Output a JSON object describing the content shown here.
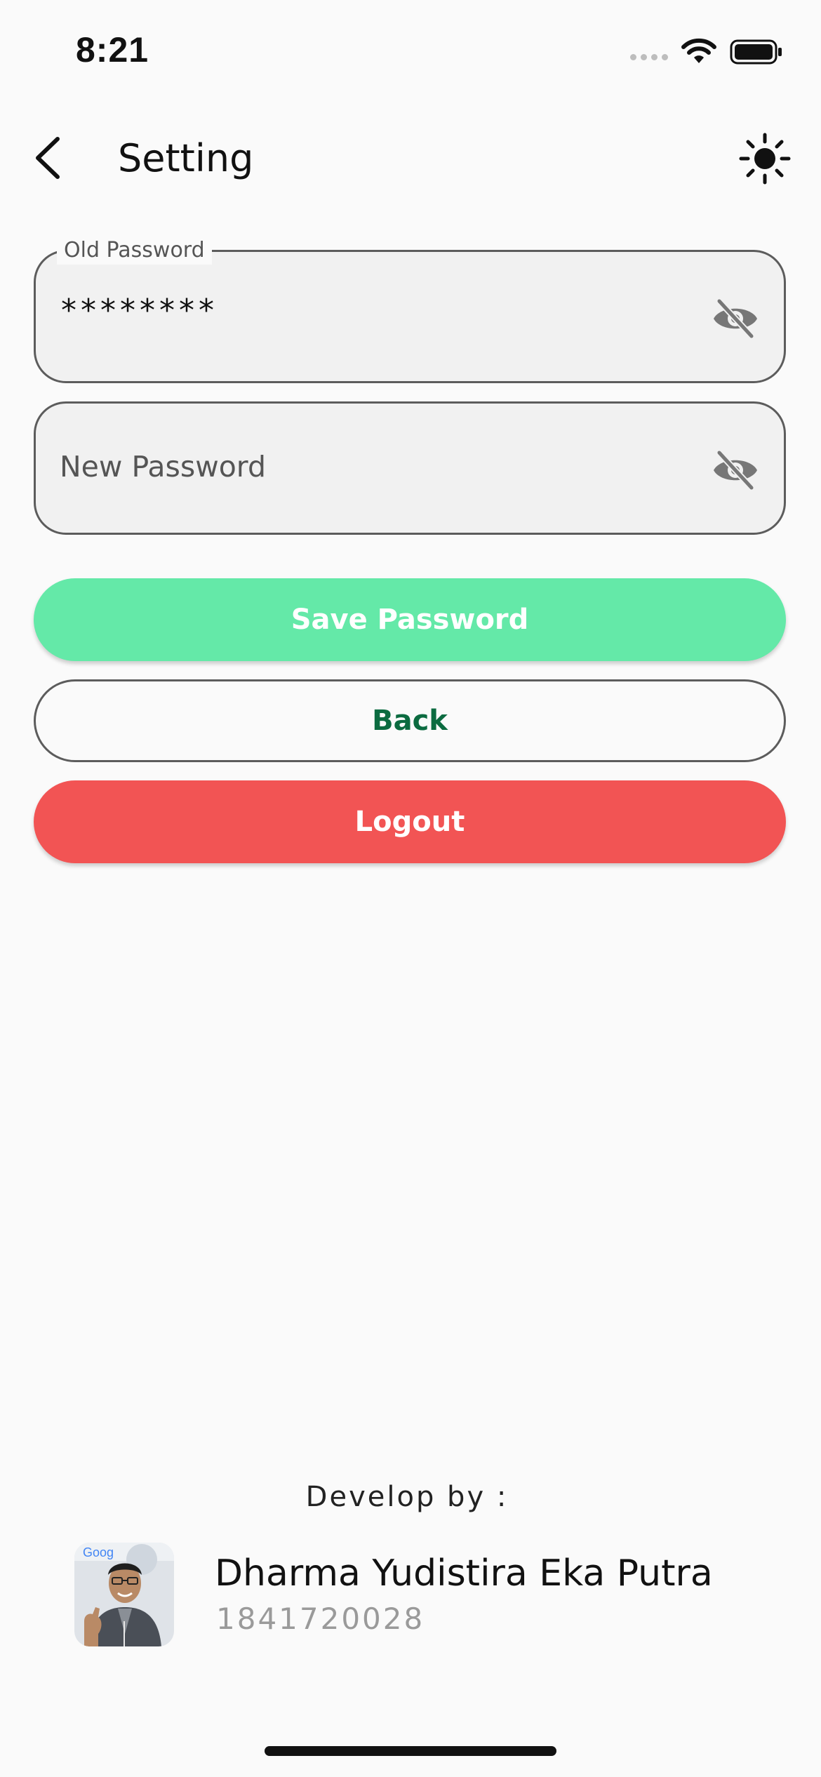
{
  "status_bar": {
    "time": "8:21",
    "wifi_icon": "wifi-icon",
    "battery_icon": "battery-icon"
  },
  "header": {
    "title": "Setting",
    "back_icon": "chevron-left-icon",
    "theme_icon": "sun-icon"
  },
  "form": {
    "old_password": {
      "label": "Old Password",
      "value": "********",
      "visibility_icon": "eye-off-icon"
    },
    "new_password": {
      "placeholder": "New Password",
      "visibility_icon": "eye-off-icon"
    }
  },
  "buttons": {
    "save_label": "Save Password",
    "back_label": "Back",
    "logout_label": "Logout"
  },
  "colors": {
    "save_button": "#64e9a8",
    "back_text": "#0b6b40",
    "logout_button": "#f25454",
    "background": "#fafafa"
  },
  "developer": {
    "label": "Develop by :",
    "name": "Dharma Yudistira Eka Putra",
    "id": "1841720028"
  }
}
